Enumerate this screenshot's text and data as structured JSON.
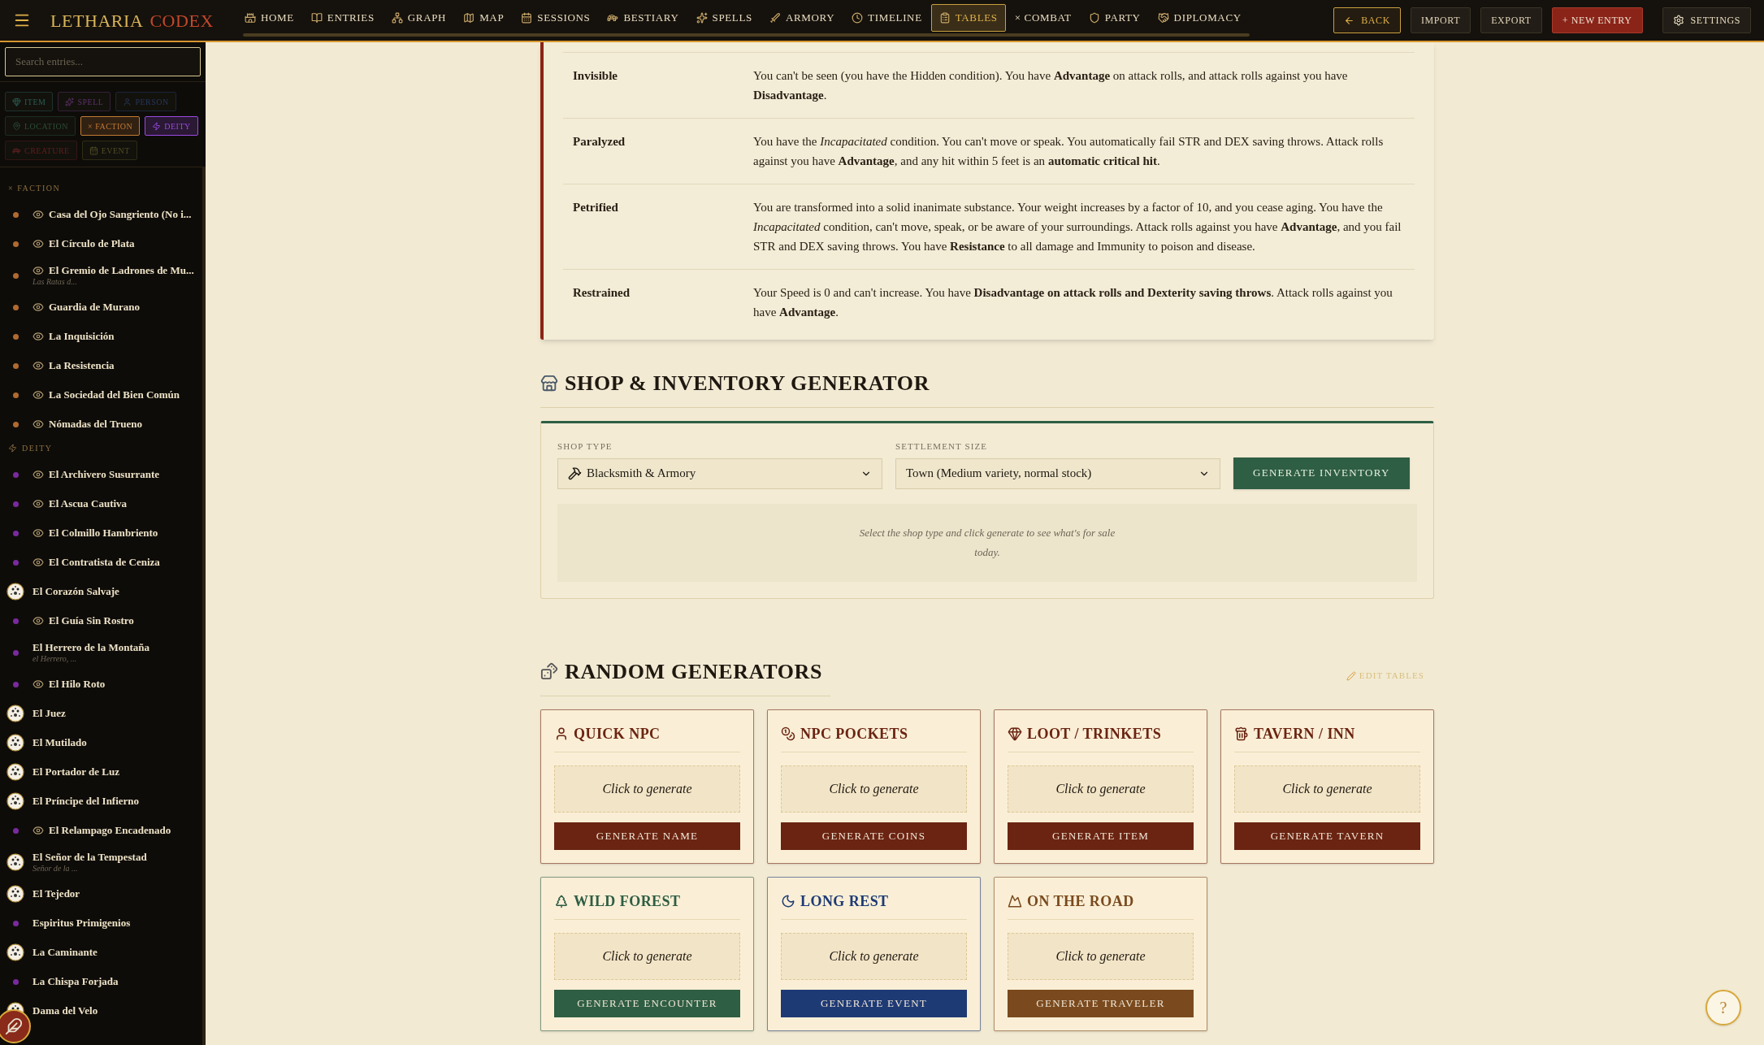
{
  "header": {
    "logo": [
      "LETHARIA",
      "CODEX"
    ],
    "nav": [
      {
        "label": "HOME",
        "selected": false
      },
      {
        "label": "ENTRIES",
        "selected": false
      },
      {
        "label": "GRAPH",
        "selected": false
      },
      {
        "label": "MAP",
        "selected": false
      },
      {
        "label": "SESSIONS",
        "selected": false
      },
      {
        "label": "BESTIARY",
        "selected": false
      },
      {
        "label": "SPELLS",
        "selected": false
      },
      {
        "label": "ARMORY",
        "selected": false
      },
      {
        "label": "TIMELINE",
        "selected": false
      },
      {
        "label": "TABLES",
        "selected": true
      },
      {
        "label": "× COMBAT",
        "selected": false
      },
      {
        "label": "PARTY",
        "selected": false
      },
      {
        "label": "DIPLOMACY",
        "selected": false
      }
    ],
    "actions": [
      {
        "label": "BACK",
        "kind": "back"
      },
      {
        "label": "IMPORT",
        "kind": "plain"
      },
      {
        "label": "EXPORT",
        "kind": "plain"
      },
      {
        "label": "+ NEW ENTRY",
        "kind": "primary"
      },
      {
        "label": "SETTINGS",
        "kind": "settings"
      }
    ]
  },
  "sidebar": {
    "search": {
      "placeholder": "Search entries..."
    },
    "filters": [
      {
        "label": "ITEM",
        "kind": "item",
        "selected": false
      },
      {
        "label": "SPELL",
        "kind": "spell",
        "selected": false
      },
      {
        "label": "PERSON",
        "kind": "person",
        "selected": false
      },
      {
        "label": "LOCATION",
        "kind": "location",
        "selected": false
      },
      {
        "label": "× FACTION",
        "kind": "faction",
        "selected": true
      },
      {
        "label": "DEITY",
        "kind": "deity",
        "selected": true
      },
      {
        "label": "CREATURE",
        "kind": "creature",
        "selected": false
      },
      {
        "label": "EVENT",
        "kind": "event",
        "selected": false
      }
    ],
    "groups": [
      {
        "title": "× FACTION",
        "kind": "faction",
        "entries": [
          {
            "name": "Casa del Ojo Sangriento (No i...",
            "kind": "dot",
            "hidden": true
          },
          {
            "name": "El Círculo de Plata",
            "kind": "dot",
            "hidden": true
          },
          {
            "name": "El Gremio de Ladrones de Mu...",
            "subtitle": "Las Ratas d...",
            "kind": "dot",
            "hidden": true
          },
          {
            "name": "Guardia de Murano",
            "kind": "dot",
            "hidden": true
          },
          {
            "name": "La Inquisición",
            "kind": "dot",
            "hidden": true
          },
          {
            "name": "La Resistencia",
            "kind": "dot",
            "hidden": true
          },
          {
            "name": "La Sociedad del Bien Común",
            "kind": "dot",
            "hidden": true
          },
          {
            "name": "Nómadas del Trueno",
            "kind": "dot",
            "hidden": true
          }
        ]
      },
      {
        "title": "DEITY",
        "kind": "deity",
        "entries": [
          {
            "name": "El Archivero Susurrante",
            "kind": "dot",
            "hidden": true
          },
          {
            "name": "El Ascua Cautiva",
            "kind": "dot",
            "hidden": true
          },
          {
            "name": "El Colmillo Hambriento",
            "kind": "dot",
            "hidden": true
          },
          {
            "name": "El Contratista de Ceniza",
            "kind": "dot",
            "hidden": true
          },
          {
            "name": "El Corazón Salvaje",
            "kind": "avatar",
            "hidden": false
          },
          {
            "name": "El Guía Sin Rostro",
            "kind": "dot",
            "hidden": true
          },
          {
            "name": "El Herrero de la Montaña",
            "subtitle": "el Herrero, ...",
            "kind": "dot",
            "hidden": false
          },
          {
            "name": "El Hilo Roto",
            "kind": "dot",
            "hidden": true
          },
          {
            "name": "El Juez",
            "kind": "avatar",
            "hidden": false
          },
          {
            "name": "El Mutilado",
            "kind": "avatar",
            "hidden": false
          },
          {
            "name": "El Portador de Luz",
            "kind": "avatar",
            "hidden": false
          },
          {
            "name": "El Príncipe del Infierno",
            "kind": "avatar",
            "hidden": false
          },
          {
            "name": "El Relampago Encadenado",
            "kind": "dot",
            "hidden": true
          },
          {
            "name": "El Señor de la Tempestad",
            "subtitle": "Señor de la ...",
            "kind": "avatar",
            "hidden": false
          },
          {
            "name": "El Tejedor",
            "kind": "avatar",
            "hidden": false
          },
          {
            "name": "Espiritus Primigenios",
            "kind": "dot",
            "hidden": false
          },
          {
            "name": "La Caminante",
            "kind": "avatar",
            "hidden": false
          },
          {
            "name": "La Chispa Forjada",
            "kind": "dot",
            "hidden": false
          },
          {
            "name": "Dama del Velo",
            "kind": "avatar",
            "hidden": false
          }
        ]
      }
    ]
  },
  "conditions": [
    {
      "name": "Invisible",
      "text": "You can't be seen (you have the Hidden condition). You have **Advantage** on attack rolls, and attack rolls against you have **Disadvantage**."
    },
    {
      "name": "Paralyzed",
      "text": "You have the *Incapacitated* condition. You can't move or speak. You automatically fail STR and DEX saving throws. Attack rolls against you have **Advantage**, and any hit within 5 feet is an **automatic critical hit**."
    },
    {
      "name": "Petrified",
      "text": "You are transformed into a solid inanimate substance. Your weight increases by a factor of 10, and you cease aging. You have the *Incapacitated* condition, can't move, speak, or be aware of your surroundings. Attack rolls against you have **Advantage**, and you fail STR and DEX saving throws. You have **Resistance** to all damage and Immunity to poison and disease."
    },
    {
      "name": "Restrained",
      "text": "Your Speed is 0 and can't increase. You have **Disadvantage on attack rolls and Dexterity saving throws**. Attack rolls against you have **Advantage**."
    }
  ],
  "shop": {
    "title": "SHOP & INVENTORY GENERATOR",
    "shop_type": {
      "label": "SHOP TYPE",
      "value": "Blacksmith & Armory"
    },
    "settlement_size": {
      "label": "SETTLEMENT SIZE",
      "value": "Town (Medium variety, normal stock)"
    },
    "button": "GENERATE INVENTORY",
    "empty_text": "Select the shop type and click generate to see what's for sale today."
  },
  "random": {
    "title": "RANDOM GENERATORS",
    "edit_link": "EDIT TABLES",
    "cards": [
      {
        "title": "QUICK NPC",
        "result": "Click to generate",
        "button": "GENERATE NAME",
        "color": "#6b2412"
      },
      {
        "title": "NPC POCKETS",
        "result": "Click to generate",
        "button": "GENERATE COINS",
        "color": "#6b2412"
      },
      {
        "title": "LOOT / TRINKETS",
        "result": "Click to generate",
        "button": "GENERATE ITEM",
        "color": "#6b2412"
      },
      {
        "title": "TAVERN / INN",
        "result": "Click to generate",
        "button": "GENERATE TAVERN",
        "color": "#6b2412"
      },
      {
        "title": "WILD FOREST",
        "result": "Click to generate",
        "button": "GENERATE ENCOUNTER",
        "color": "#2e5e44"
      },
      {
        "title": "LONG REST",
        "result": "Click to generate",
        "button": "GENERATE EVENT",
        "color": "#1e3a75"
      },
      {
        "title": "ON THE ROAD",
        "result": "Click to generate",
        "button": "GENERATE TRAVELER",
        "color": "#7a4a1e"
      }
    ]
  },
  "help_button": "?"
}
